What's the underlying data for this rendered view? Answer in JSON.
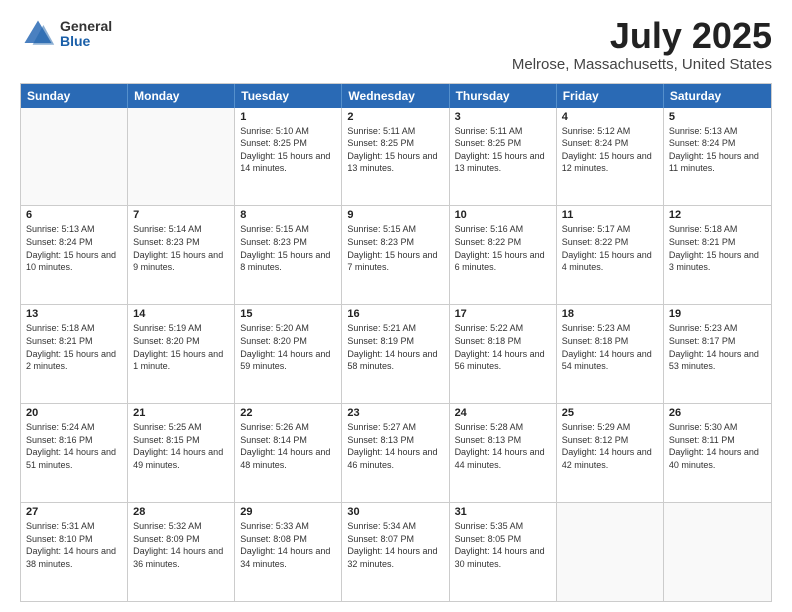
{
  "logo": {
    "general": "General",
    "blue": "Blue"
  },
  "title": "July 2025",
  "subtitle": "Melrose, Massachusetts, United States",
  "days": [
    "Sunday",
    "Monday",
    "Tuesday",
    "Wednesday",
    "Thursday",
    "Friday",
    "Saturday"
  ],
  "weeks": [
    [
      {
        "day": "",
        "sunrise": "",
        "sunset": "",
        "daylight": ""
      },
      {
        "day": "",
        "sunrise": "",
        "sunset": "",
        "daylight": ""
      },
      {
        "day": "1",
        "sunrise": "Sunrise: 5:10 AM",
        "sunset": "Sunset: 8:25 PM",
        "daylight": "Daylight: 15 hours and 14 minutes."
      },
      {
        "day": "2",
        "sunrise": "Sunrise: 5:11 AM",
        "sunset": "Sunset: 8:25 PM",
        "daylight": "Daylight: 15 hours and 13 minutes."
      },
      {
        "day": "3",
        "sunrise": "Sunrise: 5:11 AM",
        "sunset": "Sunset: 8:25 PM",
        "daylight": "Daylight: 15 hours and 13 minutes."
      },
      {
        "day": "4",
        "sunrise": "Sunrise: 5:12 AM",
        "sunset": "Sunset: 8:24 PM",
        "daylight": "Daylight: 15 hours and 12 minutes."
      },
      {
        "day": "5",
        "sunrise": "Sunrise: 5:13 AM",
        "sunset": "Sunset: 8:24 PM",
        "daylight": "Daylight: 15 hours and 11 minutes."
      }
    ],
    [
      {
        "day": "6",
        "sunrise": "Sunrise: 5:13 AM",
        "sunset": "Sunset: 8:24 PM",
        "daylight": "Daylight: 15 hours and 10 minutes."
      },
      {
        "day": "7",
        "sunrise": "Sunrise: 5:14 AM",
        "sunset": "Sunset: 8:23 PM",
        "daylight": "Daylight: 15 hours and 9 minutes."
      },
      {
        "day": "8",
        "sunrise": "Sunrise: 5:15 AM",
        "sunset": "Sunset: 8:23 PM",
        "daylight": "Daylight: 15 hours and 8 minutes."
      },
      {
        "day": "9",
        "sunrise": "Sunrise: 5:15 AM",
        "sunset": "Sunset: 8:23 PM",
        "daylight": "Daylight: 15 hours and 7 minutes."
      },
      {
        "day": "10",
        "sunrise": "Sunrise: 5:16 AM",
        "sunset": "Sunset: 8:22 PM",
        "daylight": "Daylight: 15 hours and 6 minutes."
      },
      {
        "day": "11",
        "sunrise": "Sunrise: 5:17 AM",
        "sunset": "Sunset: 8:22 PM",
        "daylight": "Daylight: 15 hours and 4 minutes."
      },
      {
        "day": "12",
        "sunrise": "Sunrise: 5:18 AM",
        "sunset": "Sunset: 8:21 PM",
        "daylight": "Daylight: 15 hours and 3 minutes."
      }
    ],
    [
      {
        "day": "13",
        "sunrise": "Sunrise: 5:18 AM",
        "sunset": "Sunset: 8:21 PM",
        "daylight": "Daylight: 15 hours and 2 minutes."
      },
      {
        "day": "14",
        "sunrise": "Sunrise: 5:19 AM",
        "sunset": "Sunset: 8:20 PM",
        "daylight": "Daylight: 15 hours and 1 minute."
      },
      {
        "day": "15",
        "sunrise": "Sunrise: 5:20 AM",
        "sunset": "Sunset: 8:20 PM",
        "daylight": "Daylight: 14 hours and 59 minutes."
      },
      {
        "day": "16",
        "sunrise": "Sunrise: 5:21 AM",
        "sunset": "Sunset: 8:19 PM",
        "daylight": "Daylight: 14 hours and 58 minutes."
      },
      {
        "day": "17",
        "sunrise": "Sunrise: 5:22 AM",
        "sunset": "Sunset: 8:18 PM",
        "daylight": "Daylight: 14 hours and 56 minutes."
      },
      {
        "day": "18",
        "sunrise": "Sunrise: 5:23 AM",
        "sunset": "Sunset: 8:18 PM",
        "daylight": "Daylight: 14 hours and 54 minutes."
      },
      {
        "day": "19",
        "sunrise": "Sunrise: 5:23 AM",
        "sunset": "Sunset: 8:17 PM",
        "daylight": "Daylight: 14 hours and 53 minutes."
      }
    ],
    [
      {
        "day": "20",
        "sunrise": "Sunrise: 5:24 AM",
        "sunset": "Sunset: 8:16 PM",
        "daylight": "Daylight: 14 hours and 51 minutes."
      },
      {
        "day": "21",
        "sunrise": "Sunrise: 5:25 AM",
        "sunset": "Sunset: 8:15 PM",
        "daylight": "Daylight: 14 hours and 49 minutes."
      },
      {
        "day": "22",
        "sunrise": "Sunrise: 5:26 AM",
        "sunset": "Sunset: 8:14 PM",
        "daylight": "Daylight: 14 hours and 48 minutes."
      },
      {
        "day": "23",
        "sunrise": "Sunrise: 5:27 AM",
        "sunset": "Sunset: 8:13 PM",
        "daylight": "Daylight: 14 hours and 46 minutes."
      },
      {
        "day": "24",
        "sunrise": "Sunrise: 5:28 AM",
        "sunset": "Sunset: 8:13 PM",
        "daylight": "Daylight: 14 hours and 44 minutes."
      },
      {
        "day": "25",
        "sunrise": "Sunrise: 5:29 AM",
        "sunset": "Sunset: 8:12 PM",
        "daylight": "Daylight: 14 hours and 42 minutes."
      },
      {
        "day": "26",
        "sunrise": "Sunrise: 5:30 AM",
        "sunset": "Sunset: 8:11 PM",
        "daylight": "Daylight: 14 hours and 40 minutes."
      }
    ],
    [
      {
        "day": "27",
        "sunrise": "Sunrise: 5:31 AM",
        "sunset": "Sunset: 8:10 PM",
        "daylight": "Daylight: 14 hours and 38 minutes."
      },
      {
        "day": "28",
        "sunrise": "Sunrise: 5:32 AM",
        "sunset": "Sunset: 8:09 PM",
        "daylight": "Daylight: 14 hours and 36 minutes."
      },
      {
        "day": "29",
        "sunrise": "Sunrise: 5:33 AM",
        "sunset": "Sunset: 8:08 PM",
        "daylight": "Daylight: 14 hours and 34 minutes."
      },
      {
        "day": "30",
        "sunrise": "Sunrise: 5:34 AM",
        "sunset": "Sunset: 8:07 PM",
        "daylight": "Daylight: 14 hours and 32 minutes."
      },
      {
        "day": "31",
        "sunrise": "Sunrise: 5:35 AM",
        "sunset": "Sunset: 8:05 PM",
        "daylight": "Daylight: 14 hours and 30 minutes."
      },
      {
        "day": "",
        "sunrise": "",
        "sunset": "",
        "daylight": ""
      },
      {
        "day": "",
        "sunrise": "",
        "sunset": "",
        "daylight": ""
      }
    ]
  ]
}
